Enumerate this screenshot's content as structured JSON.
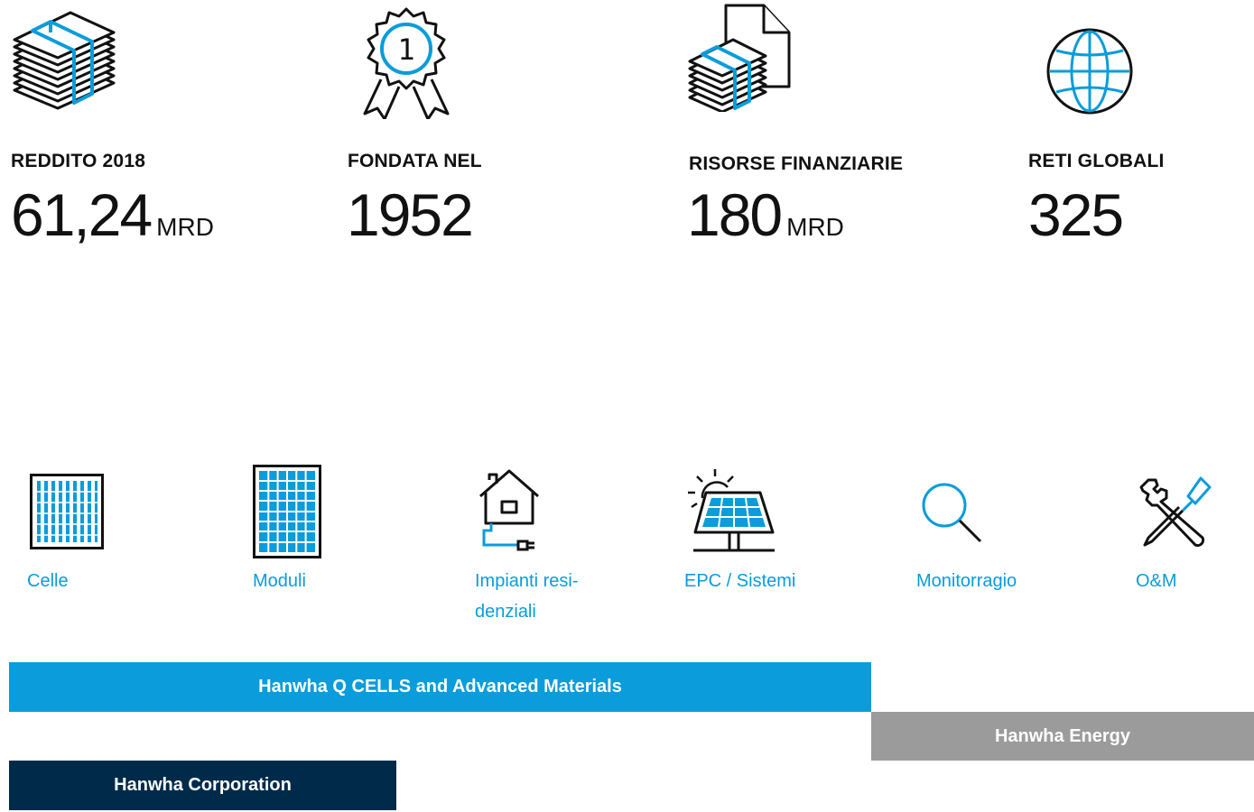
{
  "stats": [
    {
      "label": "REDDITO 2018",
      "value": "61,24",
      "unit": "MRD",
      "icon": "money-stack-icon"
    },
    {
      "label": "FONDATA NEL",
      "value": "1952",
      "unit": "",
      "icon": "award-ribbon-icon"
    },
    {
      "label": "RISORSE FINANZIARIE",
      "value": "180",
      "unit": "MRD",
      "icon": "document-money-icon"
    },
    {
      "label": "RETI GLOBALI",
      "value": "325",
      "unit": "",
      "icon": "globe-icon"
    }
  ],
  "award_number": "1",
  "value_chain": [
    {
      "label": "Celle",
      "icon": "solar-cell-icon"
    },
    {
      "label": "Moduli",
      "icon": "solar-module-icon"
    },
    {
      "label": "Impianti resi-\ndenziali",
      "icon": "house-plug-icon"
    },
    {
      "label": "EPC / Sistemi",
      "icon": "sun-panel-icon"
    },
    {
      "label": "Monitorragio",
      "icon": "magnifier-icon"
    },
    {
      "label": "O&M",
      "icon": "tools-icon"
    }
  ],
  "companies": {
    "qcells": "Hanwha Q CELLS and Advanced Materials",
    "energy": "Hanwha Energy",
    "corporation": "Hanwha Corporation"
  },
  "colors": {
    "accent": "#0a9cdb",
    "energy_gray": "#9b9b9b",
    "corporation_navy": "#002a4a",
    "ink": "#111111"
  }
}
